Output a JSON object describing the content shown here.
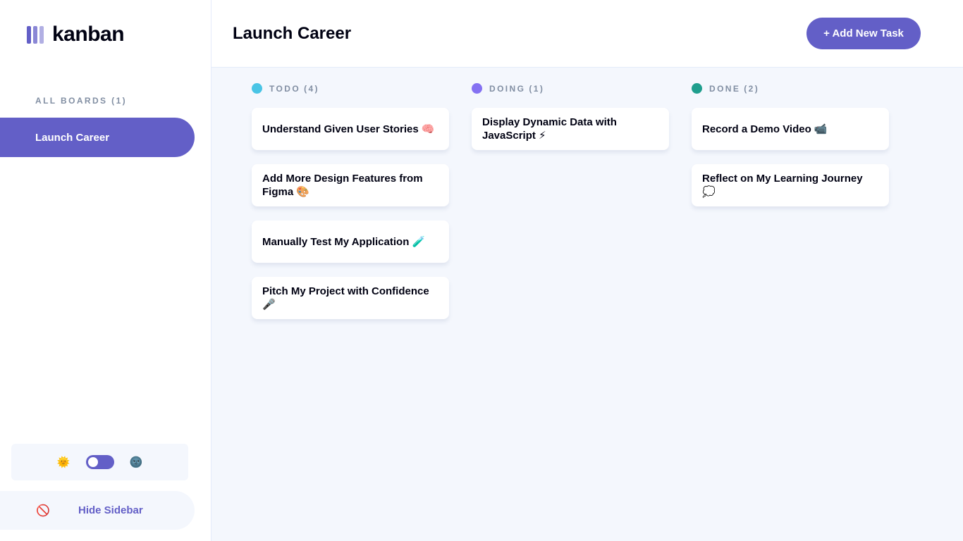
{
  "app": {
    "name": "kanban"
  },
  "sidebar": {
    "boards_heading": "ALL BOARDS (1)",
    "boards": [
      {
        "label": "Launch Career",
        "active": true
      }
    ],
    "theme": {
      "light_icon": "🌞",
      "dark_icon": "🌚",
      "mode": "light"
    },
    "hide_icon": "🚫",
    "hide_label": "Hide Sidebar"
  },
  "header": {
    "board_title": "Launch Career",
    "add_task_label": "+ Add New Task"
  },
  "colors": {
    "accent": "#635fc7",
    "todo": "#49c4e5",
    "doing": "#8471f2",
    "done": "#1f9e8d"
  },
  "columns": [
    {
      "name": "TODO",
      "count": "(4)",
      "color": "#49c4e5",
      "tasks": [
        {
          "title": "Understand Given User Stories 🧠"
        },
        {
          "title": "Add More Design Features from Figma 🎨"
        },
        {
          "title": "Manually Test My Application 🧪"
        },
        {
          "title": "Pitch My Project with Confidence 🎤"
        }
      ]
    },
    {
      "name": "DOING",
      "count": "(1)",
      "color": "#8471f2",
      "tasks": [
        {
          "title": "Display Dynamic Data with JavaScript ⚡"
        }
      ]
    },
    {
      "name": "DONE",
      "count": "(2)",
      "color": "#1f9e8d",
      "tasks": [
        {
          "title": "Record a Demo Video 📹"
        },
        {
          "title": "Reflect on My Learning Journey 💭"
        }
      ]
    }
  ]
}
